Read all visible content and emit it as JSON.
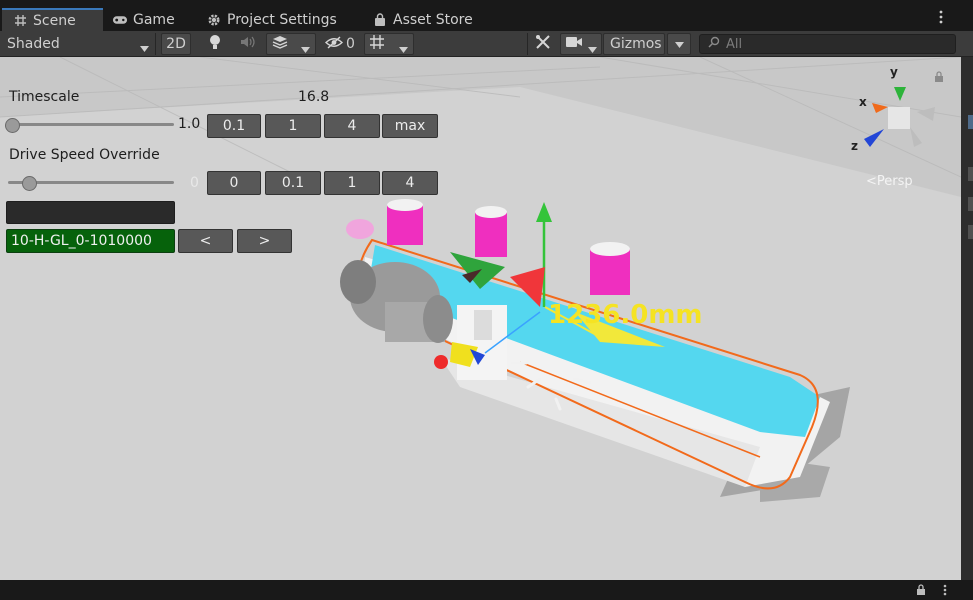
{
  "tabs": [
    {
      "label": "Scene",
      "icon": "grid-icon"
    },
    {
      "label": "Game",
      "icon": "gamepad-icon"
    },
    {
      "label": "Project Settings",
      "icon": "gear-icon"
    },
    {
      "label": "Asset Store",
      "icon": "bag-icon"
    }
  ],
  "toolbar": {
    "shading_mode": "Shaded",
    "mode_2d": "2D",
    "hidden_count": "0",
    "gizmos": "Gizmos",
    "search_placeholder": "All"
  },
  "overlay": {
    "timescale_label": "Timescale",
    "timescale_current": "16.8",
    "timescale_value": "1.0",
    "timescale_slider_fraction": 0.02,
    "timescale_buttons": [
      "0.1",
      "1",
      "4",
      "max"
    ],
    "drive_speed_label": "Drive Speed Override",
    "drive_speed_value": "0",
    "drive_speed_slider_fraction": 0.12,
    "drive_speed_buttons": [
      "0",
      "0.1",
      "1",
      "4"
    ],
    "signal_name": "10-H-GL_0-1010000",
    "prev_label": "<",
    "next_label": ">"
  },
  "scene": {
    "measurement": "1236.0mm",
    "projection": "Persp",
    "axes": {
      "x": "x",
      "y": "y",
      "z": "z"
    }
  },
  "colors": {
    "tab_active_accent": "#3a79bb",
    "signal_green": "#06620b",
    "measurement_yellow": "#f5e323",
    "conveyor_cyan": "#54d7ef",
    "conveyor_outline": "#f26a1b"
  }
}
